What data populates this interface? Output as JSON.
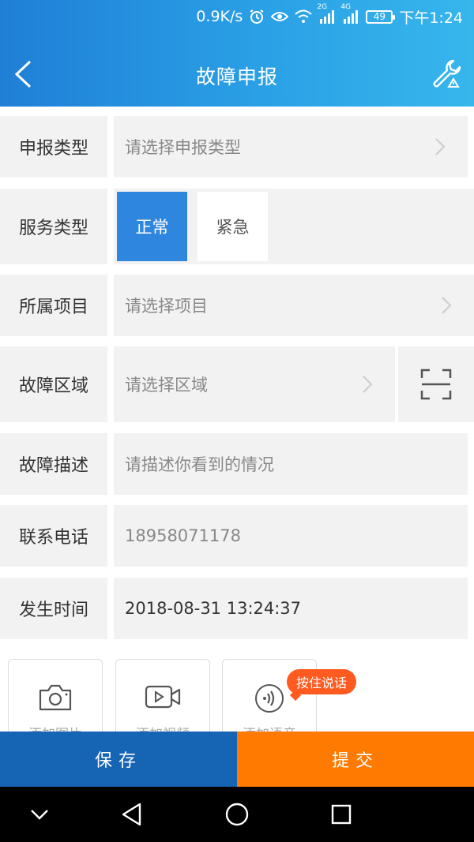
{
  "status": {
    "speed": "0.9K/s",
    "net1": "2G",
    "net2": "4G",
    "battery": "49",
    "time": "下午1:24"
  },
  "header": {
    "title": "故障申报"
  },
  "form": {
    "report_type": {
      "label": "申报类型",
      "placeholder": "请选择申报类型"
    },
    "service_type": {
      "label": "服务类型",
      "options": [
        "正常",
        "紧急"
      ],
      "selected": "正常"
    },
    "project": {
      "label": "所属项目",
      "placeholder": "请选择项目"
    },
    "area": {
      "label": "故障区域",
      "placeholder": "请选择区域"
    },
    "description": {
      "label": "故障描述",
      "placeholder": "请描述你看到的情况"
    },
    "phone": {
      "label": "联系电话",
      "value": "18958071178"
    },
    "time": {
      "label": "发生时间",
      "value": "2018-08-31 13:24:37"
    }
  },
  "media": {
    "photo": "添加图片",
    "video": "添加视频",
    "audio": "添加语音",
    "hold_to_talk": "按住说话"
  },
  "actions": {
    "save": "保存",
    "submit": "提交"
  },
  "colors": {
    "header_start": "#1f7fd6",
    "header_end": "#37b6ec",
    "active": "#2e86de",
    "save": "#1664b4",
    "submit": "#ff7a00",
    "badge": "#ff5a1f"
  }
}
